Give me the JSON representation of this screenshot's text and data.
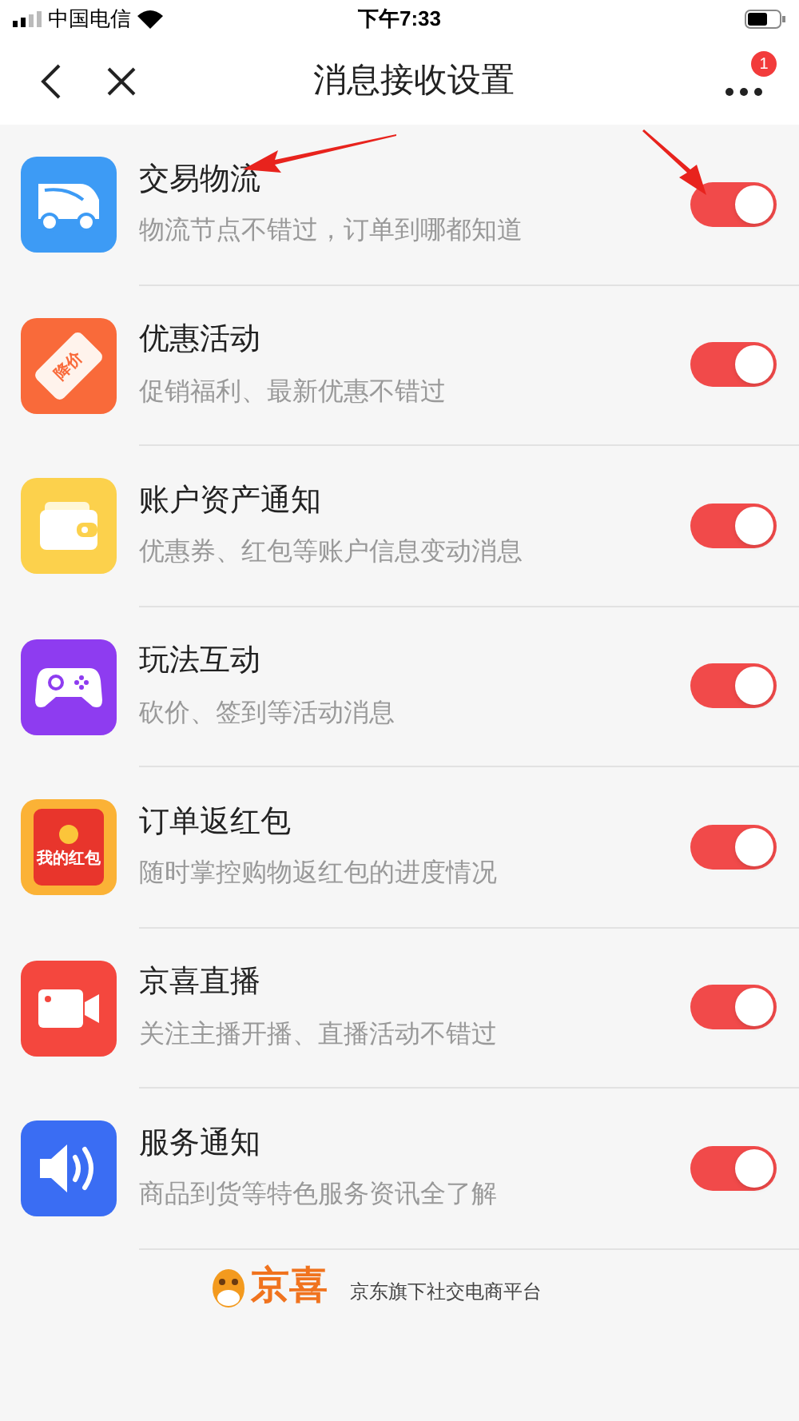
{
  "status_bar": {
    "carrier": "中国电信",
    "time": "下午7:33"
  },
  "header": {
    "title": "消息接收设置",
    "more_badge": "1"
  },
  "items": [
    {
      "kind": "truck",
      "title": "交易物流",
      "subtitle": "物流节点不错过，订单到哪都知道",
      "on": true
    },
    {
      "kind": "tag",
      "icon_text": "降价",
      "title": "优惠活动",
      "subtitle": "促销福利、最新优惠不错过",
      "on": true
    },
    {
      "kind": "wallet",
      "title": "账户资产通知",
      "subtitle": "优惠券、红包等账户信息变动消息",
      "on": true
    },
    {
      "kind": "gamepad",
      "title": "玩法互动",
      "subtitle": "砍价、签到等活动消息",
      "on": true
    },
    {
      "kind": "redpacket",
      "icon_text": "我的红包",
      "title": "订单返红包",
      "subtitle": "随时掌控购物返红包的进度情况",
      "on": true
    },
    {
      "kind": "camera",
      "title": "京喜直播",
      "subtitle": "关注主播开播、直播活动不错过",
      "on": true
    },
    {
      "kind": "speaker",
      "title": "服务通知",
      "subtitle": "商品到货等特色服务资讯全了解",
      "on": true
    }
  ],
  "footer": {
    "brand": "京喜",
    "slogan": "京东旗下社交电商平台"
  }
}
